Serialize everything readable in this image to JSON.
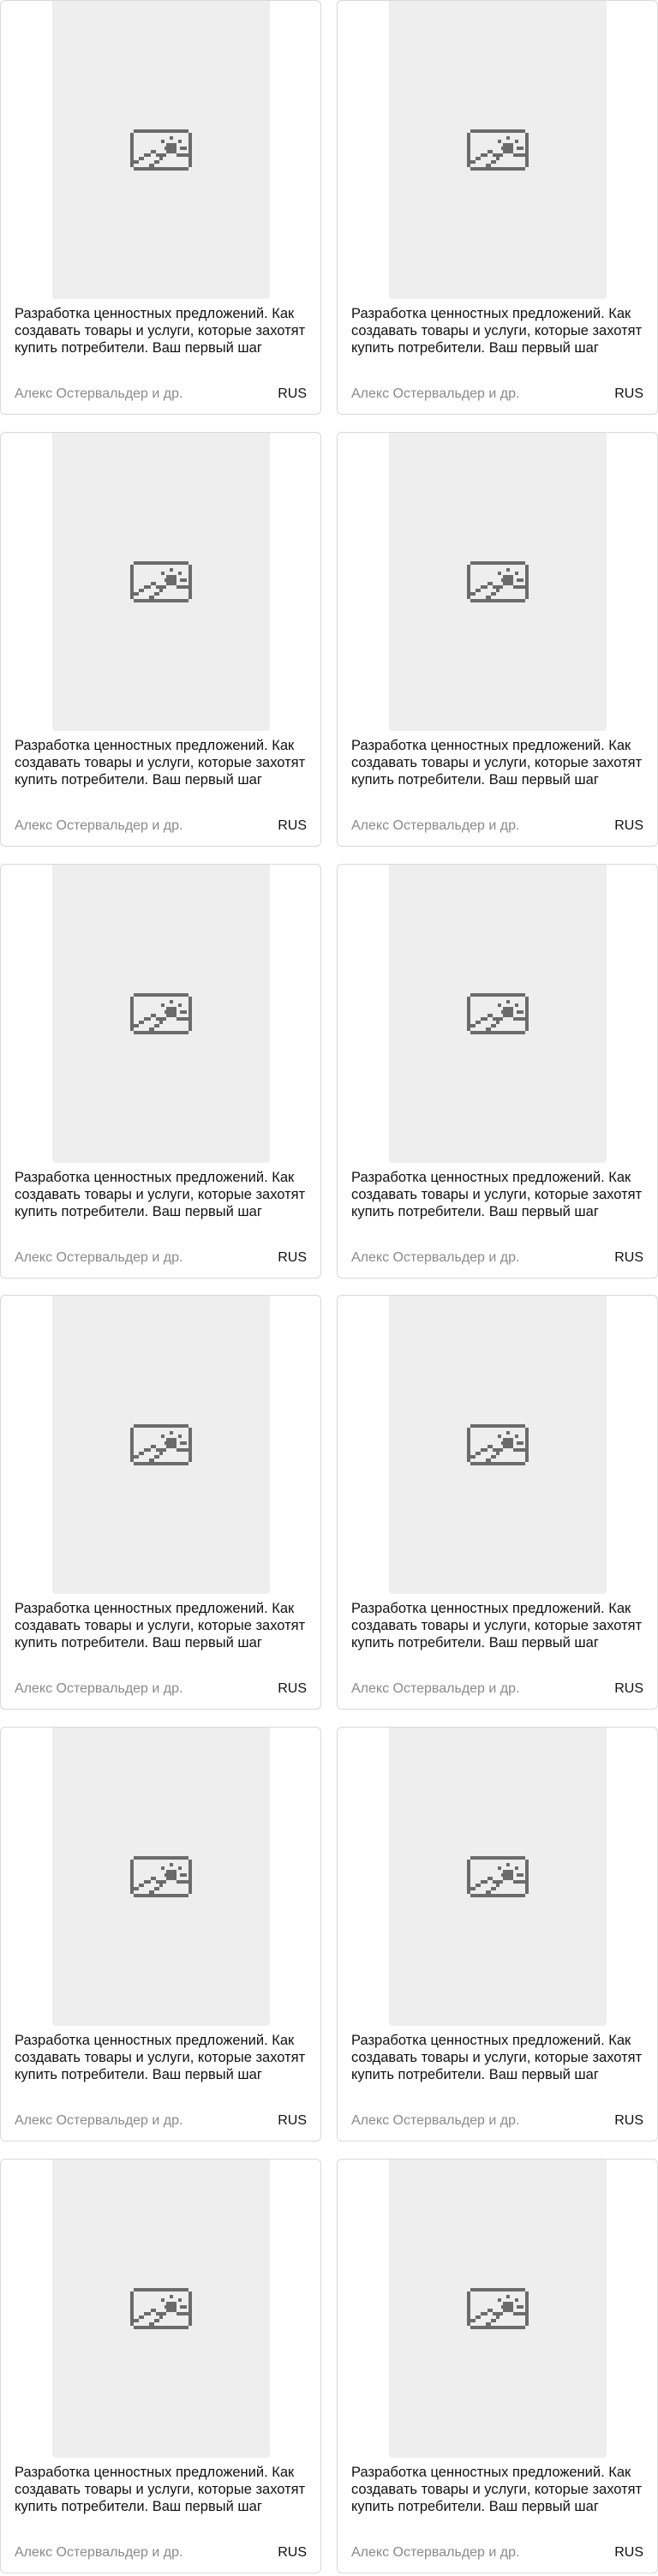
{
  "books": [
    {
      "title": "Разработка ценностных предложений. Как создавать товары и услуги, которые захотят купить потребители. Ваш первый шаг",
      "author": "Алекс Остервальдер и др.",
      "language": "RUS",
      "cover_icon": "image-placeholder-icon"
    },
    {
      "title": "Разработка ценностных предложений. Как создавать товары и услуги, которые захотят купить потребители. Ваш первый шаг",
      "author": "Алекс Остервальдер и др.",
      "language": "RUS",
      "cover_icon": "image-placeholder-icon"
    },
    {
      "title": "Разработка ценностных предложений. Как создавать товары и услуги, которые захотят купить потребители. Ваш первый шаг",
      "author": "Алекс Остервальдер и др.",
      "language": "RUS",
      "cover_icon": "image-placeholder-icon"
    },
    {
      "title": "Разработка ценностных предложений. Как создавать товары и услуги, которые захотят купить потребители. Ваш первый шаг",
      "author": "Алекс Остервальдер и др.",
      "language": "RUS",
      "cover_icon": "image-placeholder-icon"
    },
    {
      "title": "Разработка ценностных предложений. Как создавать товары и услуги, которые захотят купить потребители. Ваш первый шаг",
      "author": "Алекс Остервальдер и др.",
      "language": "RUS",
      "cover_icon": "image-placeholder-icon"
    },
    {
      "title": "Разработка ценностных предложений. Как создавать товары и услуги, которые захотят купить потребители. Ваш первый шаг",
      "author": "Алекс Остервальдер и др.",
      "language": "RUS",
      "cover_icon": "image-placeholder-icon"
    },
    {
      "title": "Разработка ценностных предложений. Как создавать товары и услуги, которые захотят купить потребители. Ваш первый шаг",
      "author": "Алекс Остервальдер и др.",
      "language": "RUS",
      "cover_icon": "image-placeholder-icon"
    },
    {
      "title": "Разработка ценностных предложений. Как создавать товары и услуги, которые захотят купить потребители. Ваш первый шаг",
      "author": "Алекс Остервальдер и др.",
      "language": "RUS",
      "cover_icon": "image-placeholder-icon"
    },
    {
      "title": "Разработка ценностных предложений. Как создавать товары и услуги, которые захотят купить потребители. Ваш первый шаг",
      "author": "Алекс Остервальдер и др.",
      "language": "RUS",
      "cover_icon": "image-placeholder-icon"
    },
    {
      "title": "Разработка ценностных предложений. Как создавать товары и услуги, которые захотят купить потребители. Ваш первый шаг",
      "author": "Алекс Остервальдер и др.",
      "language": "RUS",
      "cover_icon": "image-placeholder-icon"
    },
    {
      "title": "Разработка ценностных предложений. Как создавать товары и услуги, которые захотят купить потребители. Ваш первый шаг",
      "author": "Алекс Остервальдер и др.",
      "language": "RUS",
      "cover_icon": "image-placeholder-icon"
    },
    {
      "title": "Разработка ценностных предложений. Как создавать товары и услуги, которые захотят купить потребители. Ваш первый шаг",
      "author": "Алекс Остервальдер и др.",
      "language": "RUS",
      "cover_icon": "image-placeholder-icon"
    }
  ],
  "colors": {
    "cover_placeholder": "#eeeeee",
    "icon": "#6b6b6b",
    "title_text": "#111111",
    "author_text": "#8a8a8a",
    "card_border": "#d9d9d9"
  }
}
